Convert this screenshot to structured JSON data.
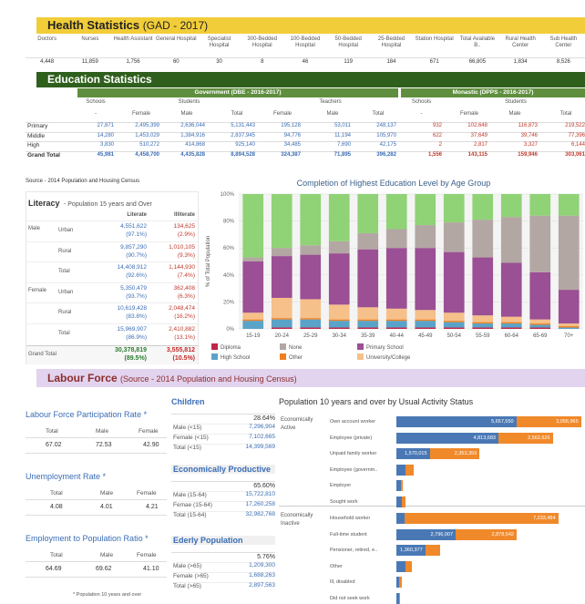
{
  "health": {
    "title": "Health Statistics",
    "subtitle": "(GAD - 2017)",
    "columns": [
      "Doctors",
      "Nurses",
      "Health Assistant",
      "General Hospital",
      "Specialist Hospital",
      "300-Bedded Hospital",
      "100-Bedded Hospital",
      "50-Bedded Hospital",
      "25-Bedded Hospital",
      "Station Hospital",
      "Total Available B..",
      "Rural Health Center",
      "Sub Health Center"
    ],
    "values": [
      "4,448",
      "11,859",
      "1,756",
      "60",
      "30",
      "8",
      "46",
      "119",
      "184",
      "671",
      "66,805",
      "1,834",
      "8,526"
    ]
  },
  "education": {
    "title": "Education Statistics",
    "gov_header": "Government (DBE - 2016-2017)",
    "mon_header": "Monastic (DPPS - 2016-2017)",
    "sub_schools": "Schools",
    "sub_students": "Students",
    "sub_teachers": "Teachers",
    "sub_dash": "-",
    "sub_female": "Female",
    "sub_male": "Male",
    "sub_total": "Total",
    "rows": [
      {
        "label": "Primary",
        "g": [
          "27,871",
          "2,495,399",
          "2,636,044",
          "5,131,443",
          "195,128",
          "53,011",
          "248,137"
        ],
        "m": [
          "932",
          "102,648",
          "116,873",
          "219,522"
        ]
      },
      {
        "label": "Middle",
        "g": [
          "14,280",
          "1,453,029",
          "1,384,916",
          "2,837,945",
          "94,776",
          "11,194",
          "105,970"
        ],
        "m": [
          "622",
          "37,649",
          "39,746",
          "77,396"
        ]
      },
      {
        "label": "High",
        "g": [
          "3,830",
          "510,272",
          "414,868",
          "925,140",
          "34,485",
          "7,690",
          "42,175"
        ],
        "m": [
          "2",
          "2,817",
          "3,327",
          "6,144"
        ]
      },
      {
        "label": "Grand Total",
        "g": [
          "45,981",
          "4,458,700",
          "4,435,828",
          "8,894,528",
          "324,387",
          "71,895",
          "396,282"
        ],
        "m": [
          "1,556",
          "143,115",
          "159,946",
          "303,061"
        ]
      }
    ]
  },
  "source_census": "Source - 2014 Population and Housing Census",
  "literacy": {
    "title": "Literacy",
    "subtitle": "- Population 15 years and Over",
    "col_literate": "Literate",
    "col_illiterate": "Illiterate",
    "rows": [
      {
        "sex": "Male",
        "area": "Urban",
        "lit": "4,551,622",
        "litp": "(97.1%)",
        "ill": "134,625",
        "illp": "(2.9%)"
      },
      {
        "sex": "",
        "area": "Rural",
        "lit": "9,857,290",
        "litp": "(90.7%)",
        "ill": "1,010,105",
        "illp": "(9.3%)"
      },
      {
        "sex": "",
        "area": "Total",
        "lit": "14,408,912",
        "litp": "(92.6%)",
        "ill": "1,144,930",
        "illp": "(7.4%)"
      },
      {
        "sex": "Female",
        "area": "Urban",
        "lit": "5,350,479",
        "litp": "(93.7%)",
        "ill": "362,408",
        "illp": "(6.3%)"
      },
      {
        "sex": "",
        "area": "Rural",
        "lit": "10,619,428",
        "litp": "(83.8%)",
        "ill": "2,048,474",
        "illp": "(16.2%)"
      },
      {
        "sex": "",
        "area": "Total",
        "lit": "15,969,907",
        "litp": "(86.9%)",
        "ill": "2,410,882",
        "illp": "(13.1%)"
      }
    ],
    "grand_label": "Grand Total",
    "grand_lit": "30,378,819",
    "grand_litp": "(89.5%)",
    "grand_ill": "3,555,812",
    "grand_illp": "(10.5%)"
  },
  "chart_data": {
    "type": "bar",
    "title": "Completion of Highest Education Level by Age Group",
    "ylabel": "% of Total Population",
    "yticks": [
      "100%",
      "80%",
      "60%",
      "40%",
      "20%",
      "0%"
    ],
    "categories": [
      "15-19",
      "20-24",
      "25-29",
      "30-34",
      "35-39",
      "40-44",
      "45-49",
      "50-54",
      "55-59",
      "60-64",
      "65-69",
      "70+"
    ],
    "series": [
      {
        "name": "Diploma",
        "color": "#c0264a",
        "values": [
          0,
          1,
          1,
          1,
          1,
          1,
          1,
          1,
          1,
          1,
          1,
          0
        ]
      },
      {
        "name": "High School",
        "color": "#5aa3c8",
        "values": [
          6,
          6,
          6,
          5,
          5,
          5,
          5,
          4,
          3,
          3,
          2,
          1
        ]
      },
      {
        "name": "Other",
        "color": "#f07f1e",
        "values": [
          1,
          1,
          1,
          1,
          1,
          1,
          1,
          1,
          1,
          1,
          1,
          1
        ]
      },
      {
        "name": "University/College",
        "color": "#f5c08a",
        "values": [
          5,
          15,
          14,
          11,
          9,
          8,
          7,
          6,
          5,
          4,
          3,
          2
        ]
      },
      {
        "name": "Primary School",
        "color": "#9b4f94",
        "values": [
          38,
          31,
          33,
          38,
          43,
          45,
          46,
          45,
          43,
          40,
          35,
          25
        ]
      },
      {
        "name": "None",
        "color": "#b3a7a3",
        "values": [
          3,
          6,
          7,
          9,
          12,
          14,
          17,
          22,
          28,
          34,
          42,
          55
        ]
      },
      {
        "name": "Middle",
        "color": "#8fd376",
        "values": [
          47,
          40,
          38,
          35,
          29,
          26,
          23,
          21,
          19,
          17,
          16,
          16
        ]
      }
    ],
    "ylim": [
      0,
      100
    ],
    "legend": "bottom"
  },
  "labour": {
    "title": "Labour Force",
    "subtitle": "(Source - 2014 Population and Housing Census)",
    "lfpr": {
      "title": "Labour Force Participation Rate *",
      "total": "67.02",
      "male": "72.53",
      "female": "42.90"
    },
    "ur": {
      "title": "Unemployment Rate *",
      "total": "4.08",
      "male": "4.01",
      "female": "4.21"
    },
    "epr": {
      "title": "Employment to Population Ratio *",
      "total": "64.69",
      "male": "69.62",
      "female": "41.10"
    },
    "col_total": "Total",
    "col_male": "Male",
    "col_female": "Female",
    "footnote": "* Population 10 years and over"
  },
  "groups": [
    {
      "title": "Children",
      "pct": "28.64%",
      "rows": [
        [
          "Male (<15)",
          "7,296,904"
        ],
        [
          "Female (<15)",
          "7,102,665"
        ],
        [
          "Total (<15)",
          "14,399,569"
        ]
      ]
    },
    {
      "title": "Economically Productive",
      "pct": "65.60%",
      "rows": [
        [
          "Male (15-64)",
          "15,722,810"
        ],
        [
          "Femae (15-64)",
          "17,260,258"
        ],
        [
          "Total (15-64)",
          "32,982,768"
        ]
      ]
    },
    {
      "title": "Ederly Population",
      "pct": "5.76%",
      "rows": [
        [
          "Male (>65)",
          "1,209,300"
        ],
        [
          "Female (>65)",
          "1,688,263"
        ],
        [
          "Total (>65)",
          "2,897,563"
        ]
      ]
    }
  ],
  "activity": {
    "title": "Population 10 years and over by Usual Activity Status",
    "active_label": "Economically Active",
    "inactive_label": "Economically Inactive",
    "blue": "#4a78b5",
    "orange": "#f0892a",
    "rows": [
      {
        "label": "Own account worker",
        "blue": 5657550,
        "orange": 3056965,
        "blue_txt": "5,657,550",
        "orange_txt": "3,056,965"
      },
      {
        "label": "Employee (private)",
        "blue": 4813683,
        "orange": 2562626,
        "blue_txt": "4,813,683",
        "orange_txt": "2,562,626"
      },
      {
        "label": "Unpaid family worker",
        "blue": 1570015,
        "orange": 2353359,
        "blue_txt": "1,570,015",
        "orange_txt": "2,353,359"
      },
      {
        "label": "Employee (governm..",
        "blue": 450000,
        "orange": 380000,
        "blue_txt": "",
        "orange_txt": ""
      },
      {
        "label": "Employer",
        "blue": 200000,
        "orange": 100000,
        "blue_txt": "",
        "orange_txt": ""
      },
      {
        "label": "Sought work",
        "blue": 250000,
        "orange": 180000,
        "blue_txt": "",
        "orange_txt": ""
      },
      {
        "label": "Household worker",
        "blue": 400000,
        "orange": 7233484,
        "blue_txt": "",
        "orange_txt": "7,233,484"
      },
      {
        "label": "Full-time student",
        "blue": 2796007,
        "orange": 2878542,
        "blue_txt": "2,796,007",
        "orange_txt": "2,878,542"
      },
      {
        "label": "Pensioner, retired, e..",
        "blue": 1360377,
        "orange": 700000,
        "blue_txt": "1,360,377",
        "orange_txt": ""
      },
      {
        "label": "Other",
        "blue": 450000,
        "orange": 300000,
        "blue_txt": "",
        "orange_txt": ""
      },
      {
        "label": "Ill, disabled",
        "blue": 150000,
        "orange": 100000,
        "blue_txt": "",
        "orange_txt": ""
      },
      {
        "label": "Did not seek work",
        "blue": 120000,
        "orange": 60000,
        "blue_txt": "",
        "orange_txt": ""
      }
    ]
  }
}
